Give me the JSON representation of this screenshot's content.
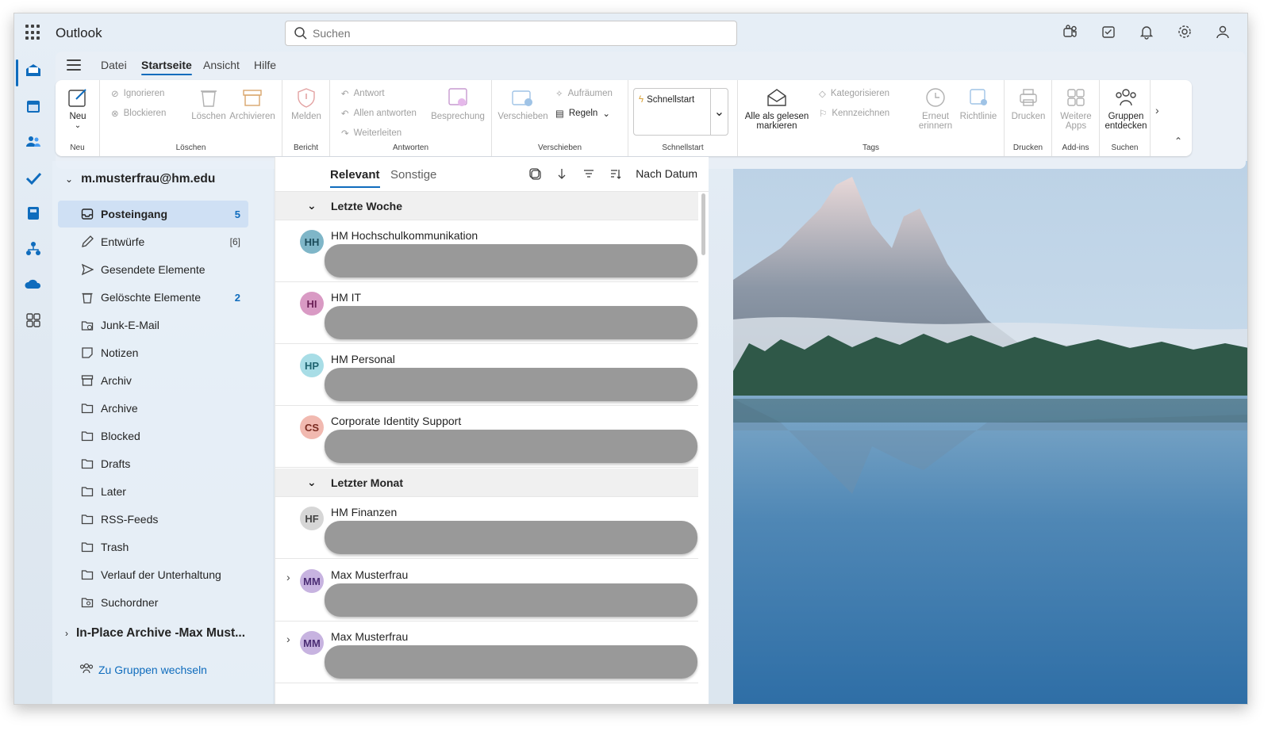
{
  "app": {
    "title": "Outlook"
  },
  "search": {
    "placeholder": "Suchen"
  },
  "menu_tabs": [
    "Datei",
    "Startseite",
    "Ansicht",
    "Hilfe"
  ],
  "ribbon": {
    "neu": {
      "label": "Neu",
      "group": "Neu"
    },
    "loeschen": {
      "ignorieren": "Ignorieren",
      "blockieren": "Blockieren",
      "loeschen": "Löschen",
      "archivieren": "Archivieren",
      "group": "Löschen"
    },
    "bericht": {
      "melden": "Melden",
      "group": "Bericht"
    },
    "antworten": {
      "antwort": "Antwort",
      "allen": "Allen antworten",
      "weiterleiten": "Weiterleiten",
      "besprechung": "Besprechung",
      "group": "Antworten"
    },
    "verschieben": {
      "verschieben": "Verschieben",
      "aufraeumen": "Aufräumen",
      "regeln": "Regeln",
      "group": "Verschieben"
    },
    "schnellstart": {
      "label": "Schnellstart",
      "group": "Schnellstart"
    },
    "tags": {
      "alle_gelesen_1": "Alle als gelesen",
      "alle_gelesen_2": "markieren",
      "kategorisieren": "Kategorisieren",
      "kennzeichnen": "Kennzeichnen",
      "erneut_1": "Erneut",
      "erneut_2": "erinnern",
      "richtlinie": "Richtlinie",
      "group": "Tags"
    },
    "drucken": {
      "label": "Drucken",
      "group": "Drucken"
    },
    "addins": {
      "label_1": "Weitere",
      "label_2": "Apps",
      "group": "Add-ins"
    },
    "suchen": {
      "label_1": "Gruppen",
      "label_2": "entdecken",
      "group": "Suchen"
    }
  },
  "folders": {
    "account": "m.musterfrau@hm.edu",
    "items": [
      {
        "label": "Posteingang",
        "count": "5",
        "icon": "inbox-icon"
      },
      {
        "label": "Entwürfe",
        "count": "[6]",
        "icon": "drafts-icon"
      },
      {
        "label": "Gesendete Elemente",
        "count": "",
        "icon": "send-icon"
      },
      {
        "label": "Gelöschte Elemente",
        "count": "2",
        "icon": "trash-icon"
      },
      {
        "label": "Junk-E-Mail",
        "count": "",
        "icon": "junk-icon"
      },
      {
        "label": "Notizen",
        "count": "",
        "icon": "note-icon"
      },
      {
        "label": "Archiv",
        "count": "",
        "icon": "archive-icon"
      },
      {
        "label": "Archive",
        "count": "",
        "icon": "folder-icon"
      },
      {
        "label": "Blocked",
        "count": "",
        "icon": "folder-icon"
      },
      {
        "label": "Drafts",
        "count": "",
        "icon": "folder-icon"
      },
      {
        "label": "Later",
        "count": "",
        "icon": "folder-icon"
      },
      {
        "label": "RSS-Feeds",
        "count": "",
        "icon": "folder-icon"
      },
      {
        "label": "Trash",
        "count": "",
        "icon": "folder-icon"
      },
      {
        "label": "Verlauf der Unterhaltung",
        "count": "",
        "icon": "folder-icon"
      },
      {
        "label": "Suchordner",
        "count": "",
        "icon": "search-folder-icon"
      }
    ],
    "archive_account": "In-Place Archive -Max Must...",
    "groups_link": "Zu Gruppen wechseln"
  },
  "message_list": {
    "tabs": [
      "Relevant",
      "Sonstige"
    ],
    "sort_label": "Nach Datum",
    "groups": [
      {
        "label": "Letzte Woche"
      },
      {
        "label": "Letzter Monat"
      }
    ],
    "messages": [
      {
        "initials": "HH",
        "sender": "HM Hochschulkommunikation",
        "avatar_bg": "#7fb6c8",
        "avatar_fg": "#1b4b5a"
      },
      {
        "initials": "HI",
        "sender": "HM IT",
        "avatar_bg": "#d99ac4",
        "avatar_fg": "#6b1f56"
      },
      {
        "initials": "HP",
        "sender": "HM Personal",
        "avatar_bg": "#a8dde6",
        "avatar_fg": "#1f6470"
      },
      {
        "initials": "CS",
        "sender": "Corporate Identity Support",
        "avatar_bg": "#f1b9b0",
        "avatar_fg": "#7a2b20"
      },
      {
        "initials": "HF",
        "sender": "HM Finanzen",
        "avatar_bg": "#d6d6d6",
        "avatar_fg": "#424242"
      },
      {
        "initials": "MM",
        "sender": "Max Musterfrau",
        "avatar_bg": "#c7b3e0",
        "avatar_fg": "#4b2d74"
      },
      {
        "initials": "MM",
        "sender": "Max Musterfrau",
        "avatar_bg": "#c7b3e0",
        "avatar_fg": "#4b2d74"
      }
    ]
  },
  "colors": {
    "accent": "#0f6cbd"
  }
}
